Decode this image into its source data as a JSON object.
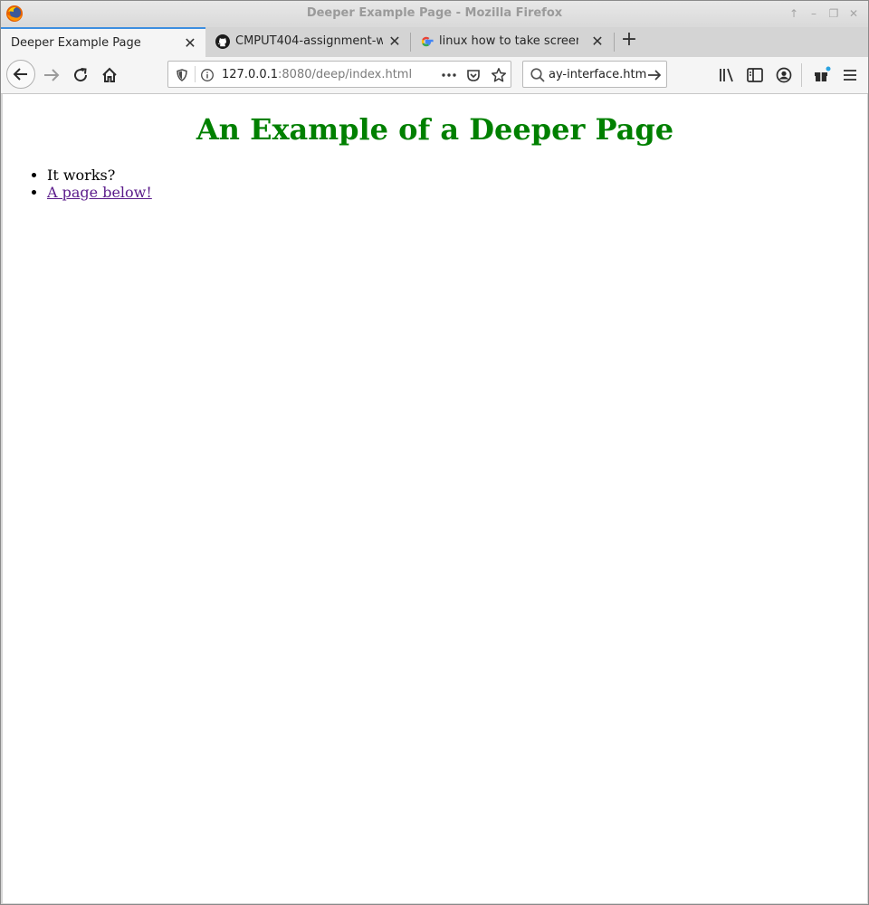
{
  "window": {
    "title": "Deeper Example Page - Mozilla Firefox"
  },
  "tabs": [
    {
      "label": "Deeper Example Page",
      "active": true,
      "icon": "none"
    },
    {
      "label": "CMPUT404-assignment-w",
      "active": false,
      "icon": "github-icon"
    },
    {
      "label": "linux how to take screen a",
      "active": false,
      "icon": "google-icon"
    }
  ],
  "navbar": {
    "url_host": "127.0.0.1",
    "url_path": ":8080/deep/index.html",
    "search_value": "ay-interface.htm"
  },
  "page": {
    "heading": "An Example of a Deeper Page",
    "heading_color": "#008000",
    "items": [
      {
        "text": "It works?",
        "link": false
      },
      {
        "text": "A page below!",
        "link": true
      }
    ],
    "link_color": "#5a1a8a"
  }
}
